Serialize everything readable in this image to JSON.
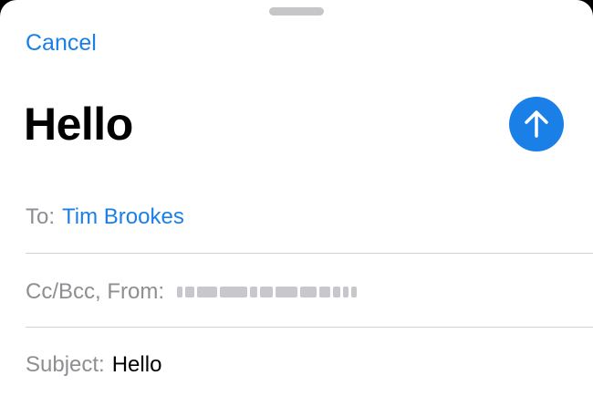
{
  "header": {
    "cancel_label": "Cancel",
    "title": "Hello",
    "send_icon": "arrow-up-icon"
  },
  "fields": {
    "to_label": "To:",
    "to_value": "Tim Brookes",
    "from_label": "Cc/Bcc, From:",
    "subject_label": "Subject:",
    "subject_value": "Hello"
  },
  "colors": {
    "accent": "#1a7fe6",
    "label_gray": "#8e8e93",
    "divider": "#d1d1d6"
  }
}
